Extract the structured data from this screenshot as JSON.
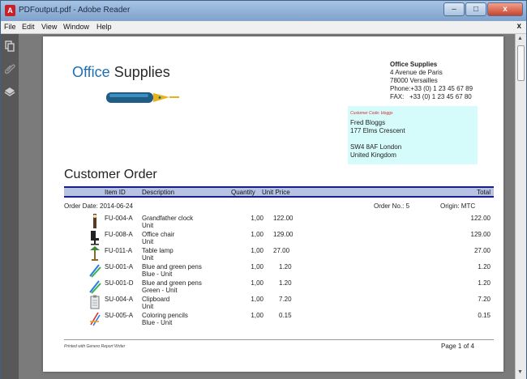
{
  "window": {
    "title": "PDFoutput.pdf - Adobe Reader",
    "app_icon": "adobe-reader-icon",
    "buttons": {
      "minimize": "–",
      "maximize": "□",
      "close": "x"
    }
  },
  "menu": {
    "items": [
      "File",
      "Edit",
      "View",
      "Window",
      "Help"
    ],
    "close": "x"
  },
  "sidebar": {
    "icons": [
      "pages-icon",
      "attachment-icon",
      "layers-icon"
    ]
  },
  "document": {
    "logo": {
      "part1": "Office",
      "part2": "Supplies",
      "image": "fountain-pen-icon"
    },
    "company": {
      "name": "Office Supplies",
      "street": "4 Avenue de Paris",
      "city": "78000 Versailles",
      "phone": "Phone:+33 (0) 1 23 45 67 89",
      "fax": "FAX:   +33 (0) 1 23 45 67 80"
    },
    "customer": {
      "code": "Customer Code: bloggs",
      "name": "Fred Bloggs",
      "street": "177 Elms Crescent",
      "postcode": "SW4 8AF London",
      "country": "United Kingdom"
    },
    "title": "Customer Order",
    "table": {
      "headers": {
        "item_id": "Item ID",
        "description": "Description",
        "quantity": "Quantity",
        "unit_price": "Unit Price",
        "total": "Total"
      }
    },
    "meta": {
      "order_date": "Order Date: 2014-06-24",
      "order_no": "Order No.: 5",
      "origin": "Origin: MTC"
    },
    "rows": [
      {
        "item_id": "FU-004-A",
        "desc1": "Grandfather clock",
        "desc2": "Unit",
        "qty": "1,00",
        "price": "122.00",
        "total": "122.00",
        "icon": "grandfather-clock-icon"
      },
      {
        "item_id": "FU-008-A",
        "desc1": "Office chair",
        "desc2": "Unit",
        "qty": "1,00",
        "price": "129.00",
        "total": "129.00",
        "icon": "office-chair-icon"
      },
      {
        "item_id": "FU-011-A",
        "desc1": "Table lamp",
        "desc2": "Unit",
        "qty": "1,00",
        "price": "27.00",
        "total": "27.00",
        "icon": "table-lamp-icon"
      },
      {
        "item_id": "SU-001-A",
        "desc1": "Blue and green pens",
        "desc2": "Blue - Unit",
        "qty": "1,00",
        "price": "1.20",
        "total": "1.20",
        "icon": "pens-icon"
      },
      {
        "item_id": "SU-001-D",
        "desc1": "Blue and green pens",
        "desc2": "Green - Unit",
        "qty": "1,00",
        "price": "1.20",
        "total": "1.20",
        "icon": "pens-icon"
      },
      {
        "item_id": "SU-004-A",
        "desc1": "Clipboard",
        "desc2": "Unit",
        "qty": "1,00",
        "price": "7.20",
        "total": "7.20",
        "icon": "clipboard-icon"
      },
      {
        "item_id": "SU-005-A",
        "desc1": "Coloring pencils",
        "desc2": "Blue - Unit",
        "qty": "1,00",
        "price": "0.15",
        "total": "0.15",
        "icon": "coloring-pencils-icon"
      }
    ],
    "footer": {
      "left": "Printed with Genero Report Writer",
      "page": "Page 1 of 4"
    }
  },
  "colors": {
    "header_band": "#b8c2e3",
    "header_rule": "#14218c",
    "customer_box": "#d6fbfb",
    "logo_blue": "#1f6eb1"
  }
}
